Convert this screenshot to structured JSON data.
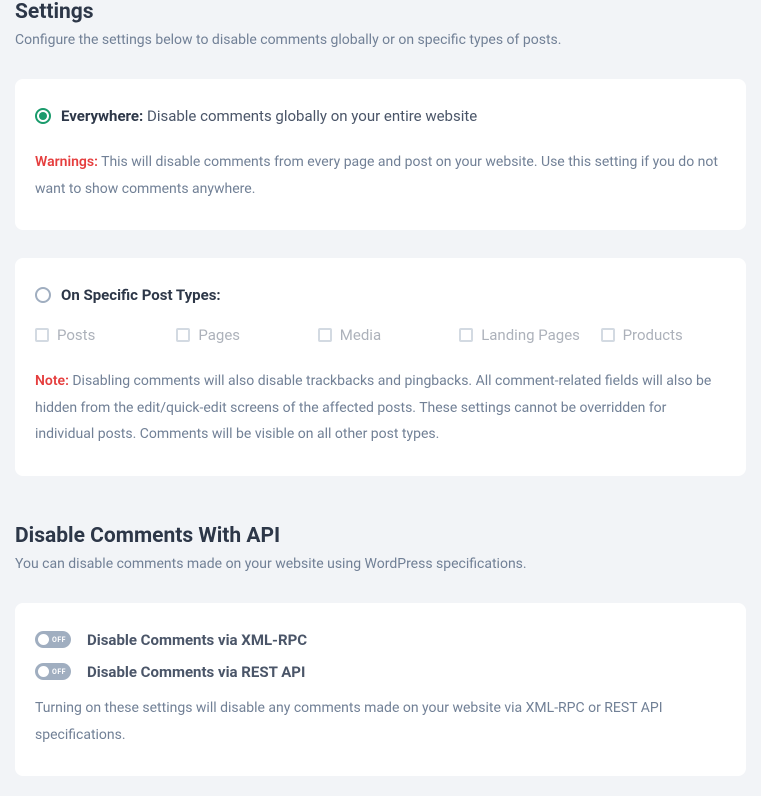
{
  "settings": {
    "title": "Settings",
    "description": "Configure the settings below to disable comments globally or on specific types of posts.",
    "everywhere": {
      "heading": "Everywhere:",
      "desc": "Disable comments globally on your entire website",
      "warning_label": "Warnings:",
      "warning_text": " This will disable comments from every page and post on your website. Use this setting if you do not want to show comments anywhere."
    },
    "specific": {
      "heading": "On Specific Post Types:",
      "types": [
        "Posts",
        "Pages",
        "Media",
        "Landing Pages",
        "Products"
      ],
      "note_label": "Note:",
      "note_text": " Disabling comments will also disable trackbacks and pingbacks. All comment-related fields will also be hidden from the edit/quick-edit screens of the affected posts. These settings cannot be overridden for individual posts. Comments will be visible on all other post types."
    }
  },
  "api": {
    "title": "Disable Comments With API",
    "description": "You can disable comments made on your website using WordPress specifications.",
    "toggles": [
      {
        "label": "Disable Comments via XML-RPC",
        "state": "OFF"
      },
      {
        "label": "Disable Comments via REST API",
        "state": "OFF"
      }
    ],
    "help_text": "Turning on these settings will disable any comments made on your website via XML-RPC or REST API specifications."
  }
}
